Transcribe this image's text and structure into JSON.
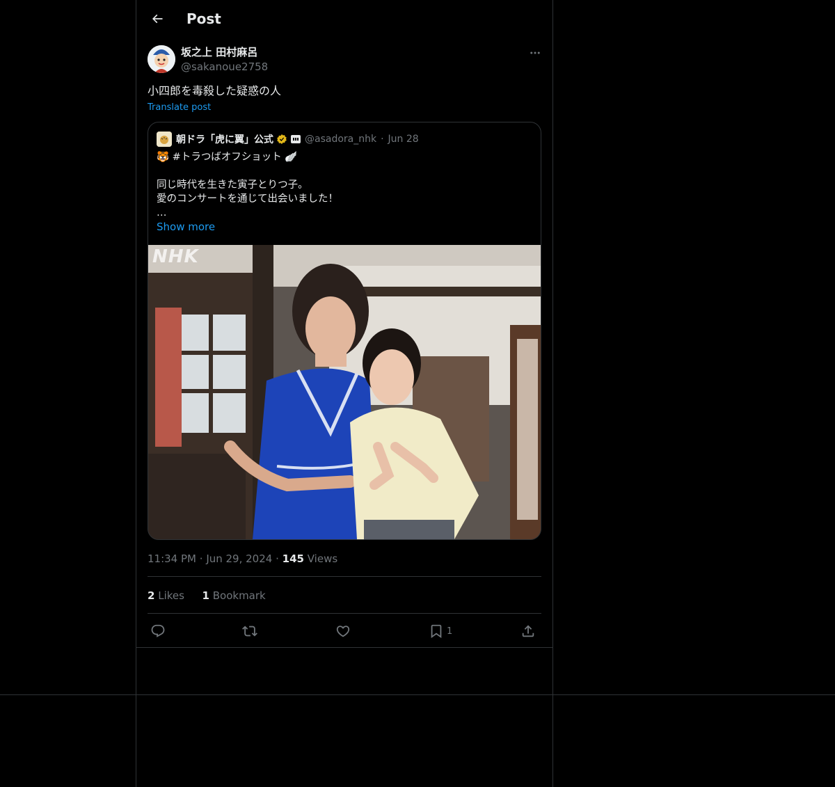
{
  "header": {
    "title": "Post"
  },
  "author": {
    "display_name": "坂之上 田村麻呂",
    "handle": "@sakanoue2758"
  },
  "post": {
    "text": "小四郎を毒殺した疑惑の人",
    "translate_label": "Translate post",
    "time": "11:34 PM",
    "date": "Jun 29, 2024",
    "views_count": "145",
    "views_label": "Views",
    "likes_count": "2",
    "likes_label": "Likes",
    "bookmarks_count": "1",
    "bookmarks_label": "Bookmark"
  },
  "quote": {
    "display_name": "朝ドラ「虎に翼」公式",
    "handle": "@asadora_nhk",
    "date": "Jun 28",
    "text": "🐯 #トラつばオフショット 🪽\n\n同じ時代を生きた寅子とりつ子。\n愛のコンサートを通じて出会いました！\n…",
    "show_more": "Show more",
    "image_watermark": "NHK"
  },
  "actions": {
    "bookmark_count": "1"
  },
  "colors": {
    "background": "#000000",
    "text": "#e7e9ea",
    "muted": "#71767b",
    "link": "#1d9bf0",
    "border": "#2f3336",
    "verified": "#e2b719"
  },
  "icons": [
    "back-arrow-icon",
    "more-icon",
    "verified-badge-icon",
    "reply-icon",
    "retweet-icon",
    "like-icon",
    "bookmark-icon",
    "share-icon"
  ]
}
